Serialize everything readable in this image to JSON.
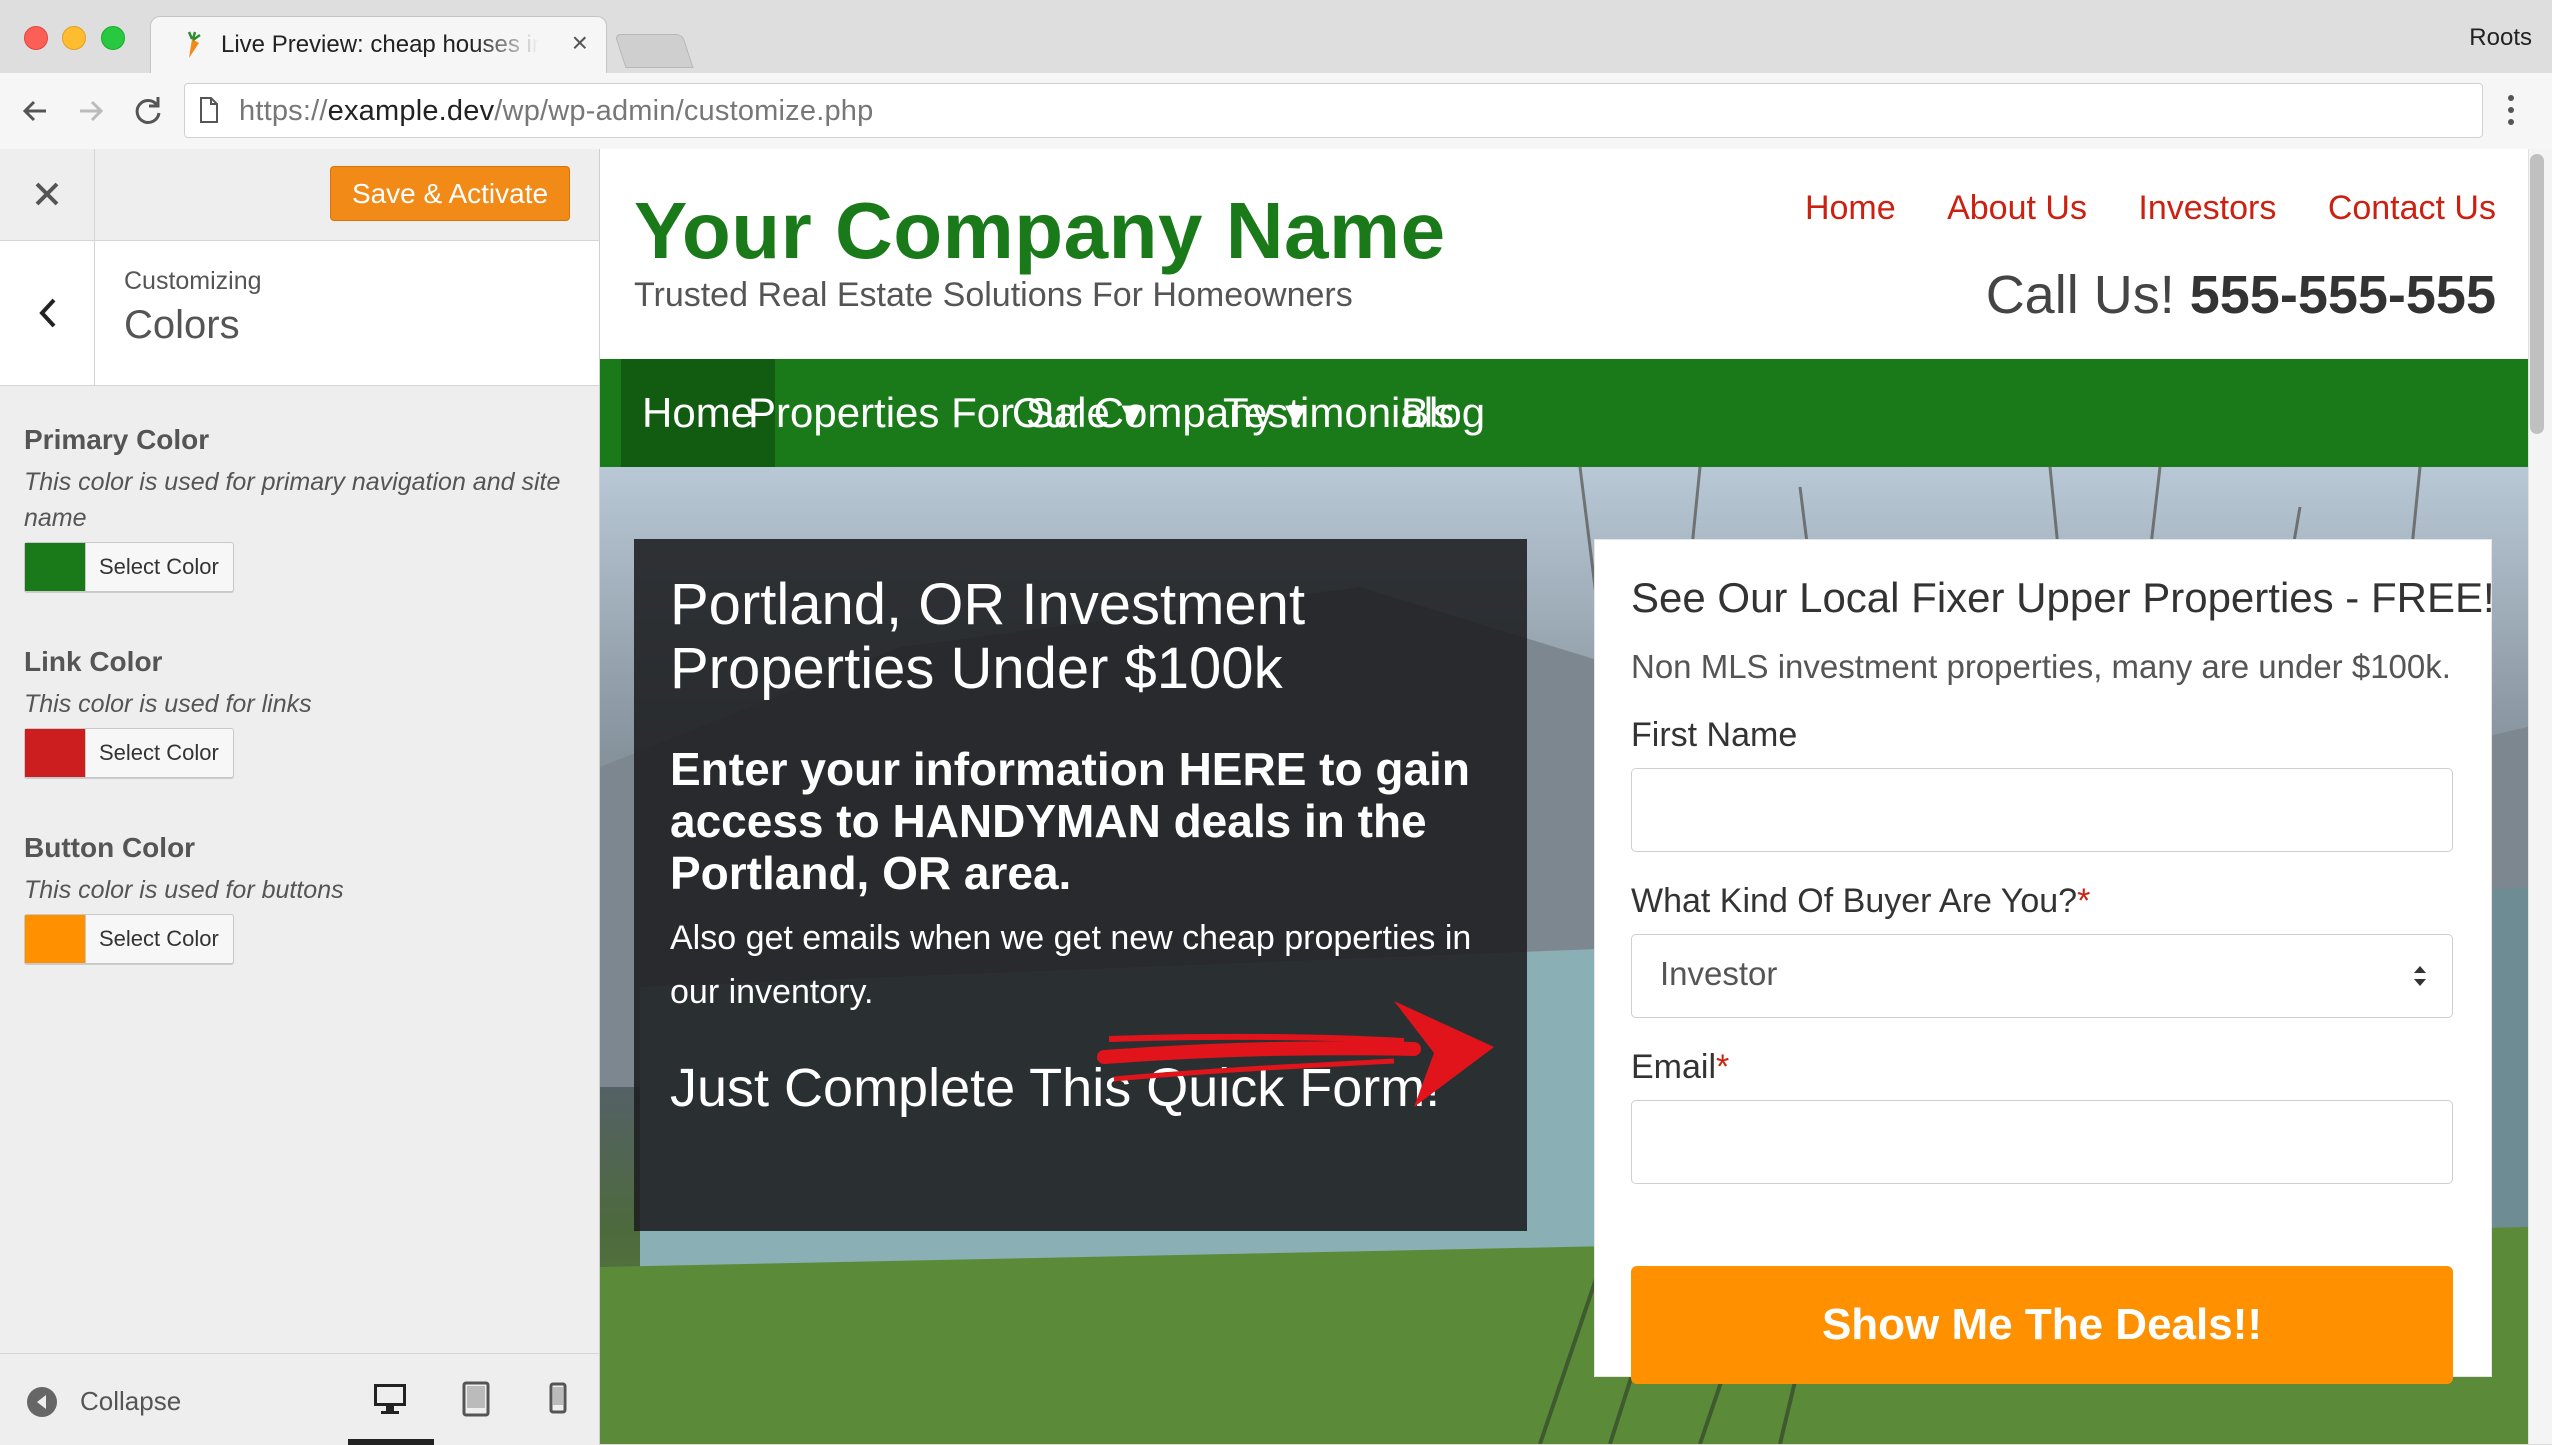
{
  "browser": {
    "tab_title": "Live Preview: cheap houses in Portland, OR",
    "tab_close": "×",
    "profile": "Roots",
    "url_scheme": "https://",
    "url_host": "example.dev",
    "url_path": "/wp/wp-admin/customize.php"
  },
  "customizer": {
    "save_label": "Save & Activate",
    "customizing_label": "Customizing",
    "section_title": "Colors",
    "controls": [
      {
        "title": "Primary Color",
        "description": "This color is used for primary navigation and site name",
        "button": "Select Color",
        "color": "#1a7a1a"
      },
      {
        "title": "Link Color",
        "description": "This color is used for links",
        "button": "Select Color",
        "color": "#cc1e1e"
      },
      {
        "title": "Button Color",
        "description": "This color is used for buttons",
        "button": "Select Color",
        "color": "#ff9000"
      }
    ],
    "collapse_label": "Collapse",
    "devices": [
      "desktop-icon",
      "tablet-icon",
      "mobile-icon"
    ],
    "active_device": "desktop"
  },
  "site": {
    "name": "Your Company Name",
    "tagline": "Trusted Real Estate Solutions For Homeowners",
    "top_links": [
      "Home",
      "About Us",
      "Investors",
      "Contact Us"
    ],
    "call_prefix": "Call Us!",
    "phone": "555-555-555",
    "nav": [
      {
        "label": "Home",
        "active": true
      },
      {
        "label": "Properties For Sale ▾",
        "active": false
      },
      {
        "label": "Our Company ▾",
        "active": false
      },
      {
        "label": "Testimonials",
        "active": false
      },
      {
        "label": "Blog",
        "active": false
      }
    ],
    "colors": {
      "primary": "#1a7a1a",
      "link": "#cc2010",
      "button": "#ff9000"
    }
  },
  "hero": {
    "heading": "Portland, OR Investment Properties Under $100k",
    "subheading": "Enter your information HERE to gain access to HANDYMAN deals in the Portland, OR area.",
    "paragraph": "Also get emails when we get new cheap properties in our inventory.",
    "cta_line": "Just Complete This Quick Form!"
  },
  "form": {
    "heading": "See Our Local Fixer Upper Properties - FREE!",
    "subheading": "Non MLS investment properties, many are under $100k.",
    "first_name_label": "First Name",
    "first_name_value": "",
    "buyer_label": "What Kind Of Buyer Are You?",
    "buyer_value": "Investor",
    "email_label": "Email",
    "email_value": "",
    "required_mark": "*",
    "submit_label": "Show Me The Deals!!"
  }
}
